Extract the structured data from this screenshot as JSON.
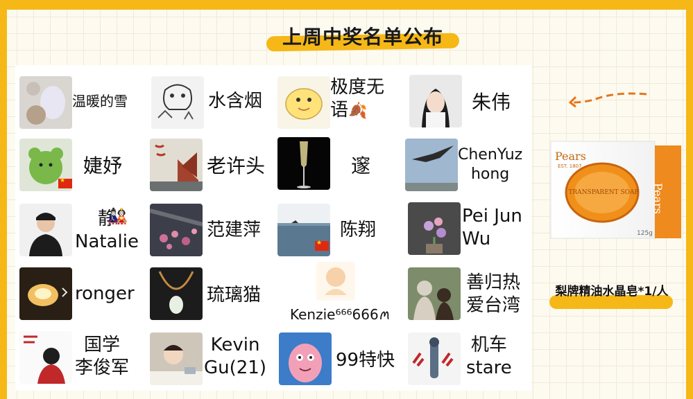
{
  "title": "上周中奖名单公布",
  "winners": [
    {
      "name": "温暖的雪",
      "flag": false,
      "emoji": ""
    },
    {
      "name": "水含烟",
      "flag": false,
      "emoji": ""
    },
    {
      "name": "极度无\n语",
      "flag": false,
      "emoji": "🍂"
    },
    {
      "name": "朱伟",
      "flag": false,
      "emoji": ""
    },
    {
      "name": "婕妤",
      "flag": true,
      "emoji": ""
    },
    {
      "name": "老许头",
      "flag": false,
      "emoji": ""
    },
    {
      "name": "邃",
      "flag": false,
      "emoji": ""
    },
    {
      "name": "ChenYuz\nhong",
      "flag": false,
      "emoji": ""
    },
    {
      "name": "静\nNatalie",
      "flag": false,
      "emoji": "🎎"
    },
    {
      "name": "范建萍",
      "flag": false,
      "emoji": ""
    },
    {
      "name": "陈翔",
      "flag": true,
      "emoji": ""
    },
    {
      "name": "Pei Jun\nWu",
      "flag": false,
      "emoji": ""
    },
    {
      "name": "ronger",
      "flag": false,
      "emoji": ""
    },
    {
      "name": "琉璃猫",
      "flag": false,
      "emoji": ""
    },
    {
      "name": "Kenzie⁶⁶⁶666ꪔ",
      "flag": false,
      "emoji": ""
    },
    {
      "name": "善归热\n爱台湾",
      "flag": false,
      "emoji": ""
    },
    {
      "name": "国学\n李俊军",
      "flag": false,
      "emoji": ""
    },
    {
      "name": "Kevin\nGu(21)",
      "flag": false,
      "emoji": ""
    },
    {
      "name": "99特快",
      "flag": false,
      "emoji": ""
    },
    {
      "name": "机车\nstare",
      "flag": false,
      "emoji": ""
    }
  ],
  "product": {
    "brand": "Pears",
    "est": "EST. 1807",
    "weight": "125g",
    "side_text": "TRANSPARENT SOAP"
  },
  "prize_label": "梨牌精油水晶皂*1/人",
  "colors": {
    "accent": "#f6b817",
    "soap": "#f0901a"
  }
}
